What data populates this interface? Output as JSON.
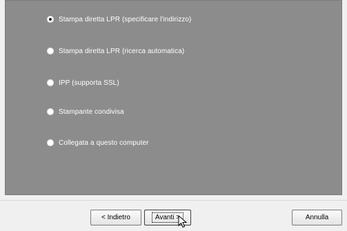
{
  "options": [
    {
      "label": "Stampa diretta LPR (specificare l'indirizzo)",
      "selected": true
    },
    {
      "label": "Stampa diretta LPR (ricerca automatica)",
      "selected": false
    },
    {
      "label": "IPP (supporta SSL)",
      "selected": false
    },
    {
      "label": "Stampante condivisa",
      "selected": false
    },
    {
      "label": "Collegata a questo computer",
      "selected": false
    }
  ],
  "buttons": {
    "back_label": "< Indietro",
    "next_label": "Avanti >",
    "cancel_label": "Annulla"
  }
}
